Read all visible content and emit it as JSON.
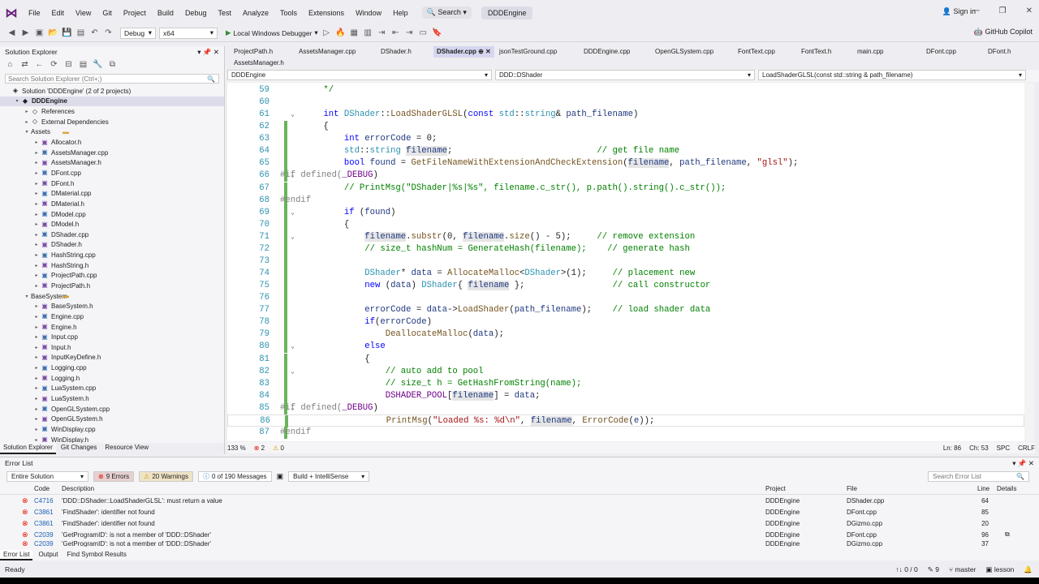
{
  "menubar": {
    "items": [
      "File",
      "Edit",
      "View",
      "Git",
      "Project",
      "Build",
      "Debug",
      "Test",
      "Analyze",
      "Tools",
      "Extensions",
      "Window",
      "Help"
    ],
    "search": "Search",
    "solution": "DDDEngine",
    "signin": "Sign in"
  },
  "toolbar": {
    "config": "Debug",
    "platform": "x64",
    "run": "Local Windows Debugger",
    "copilot": "GitHub Copilot"
  },
  "solution_explorer": {
    "title": "Solution Explorer",
    "search_placeholder": "Search Solution Explorer (Ctrl+;)",
    "rows": [
      {
        "label": "Solution 'DDDEngine' (2 of 2 projects)",
        "indent": 0,
        "icon": "sln",
        "twist": ""
      },
      {
        "label": "DDDEngine",
        "indent": 1,
        "icon": "proj",
        "twist": "▾",
        "bold": true,
        "selected": true
      },
      {
        "label": "References",
        "indent": 2,
        "icon": "ref",
        "twist": "▸"
      },
      {
        "label": "External Dependencies",
        "indent": 2,
        "icon": "ref",
        "twist": "▸"
      },
      {
        "label": "Assets",
        "indent": 2,
        "icon": "fold",
        "twist": "▾"
      },
      {
        "label": "Allocator.h",
        "indent": 3,
        "icon": "h",
        "twist": "▸"
      },
      {
        "label": "AssetsManager.cpp",
        "indent": 3,
        "icon": "cpp",
        "twist": "▸"
      },
      {
        "label": "AssetsManager.h",
        "indent": 3,
        "icon": "h",
        "twist": "▸"
      },
      {
        "label": "DFont.cpp",
        "indent": 3,
        "icon": "cpp",
        "twist": "▸"
      },
      {
        "label": "DFont.h",
        "indent": 3,
        "icon": "h",
        "twist": "▸"
      },
      {
        "label": "DMaterial.cpp",
        "indent": 3,
        "icon": "cpp",
        "twist": "▸"
      },
      {
        "label": "DMaterial.h",
        "indent": 3,
        "icon": "h",
        "twist": "▸"
      },
      {
        "label": "DModel.cpp",
        "indent": 3,
        "icon": "cpp",
        "twist": "▸"
      },
      {
        "label": "DModel.h",
        "indent": 3,
        "icon": "h",
        "twist": "▸"
      },
      {
        "label": "DShader.cpp",
        "indent": 3,
        "icon": "cpp",
        "twist": "▸"
      },
      {
        "label": "DShader.h",
        "indent": 3,
        "icon": "h",
        "twist": "▸"
      },
      {
        "label": "HashString.cpp",
        "indent": 3,
        "icon": "cpp",
        "twist": "▸"
      },
      {
        "label": "HashString.h",
        "indent": 3,
        "icon": "h",
        "twist": "▸"
      },
      {
        "label": "ProjectPath.cpp",
        "indent": 3,
        "icon": "cpp",
        "twist": "▸"
      },
      {
        "label": "ProjectPath.h",
        "indent": 3,
        "icon": "h",
        "twist": "▸"
      },
      {
        "label": "BaseSystem",
        "indent": 2,
        "icon": "fold",
        "twist": "▾"
      },
      {
        "label": "BaseSystem.h",
        "indent": 3,
        "icon": "h",
        "twist": "▸"
      },
      {
        "label": "Engine.cpp",
        "indent": 3,
        "icon": "cpp",
        "twist": "▸"
      },
      {
        "label": "Engine.h",
        "indent": 3,
        "icon": "h",
        "twist": "▸"
      },
      {
        "label": "Input.cpp",
        "indent": 3,
        "icon": "cpp",
        "twist": "▸"
      },
      {
        "label": "Input.h",
        "indent": 3,
        "icon": "h",
        "twist": "▸"
      },
      {
        "label": "InputKeyDefine.h",
        "indent": 3,
        "icon": "h",
        "twist": "▸"
      },
      {
        "label": "Logging.cpp",
        "indent": 3,
        "icon": "cpp",
        "twist": "▸"
      },
      {
        "label": "Logging.h",
        "indent": 3,
        "icon": "h",
        "twist": "▸"
      },
      {
        "label": "LuaSystem.cpp",
        "indent": 3,
        "icon": "cpp",
        "twist": "▸"
      },
      {
        "label": "LuaSystem.h",
        "indent": 3,
        "icon": "h",
        "twist": "▸"
      },
      {
        "label": "OpenGLSystem.cpp",
        "indent": 3,
        "icon": "cpp",
        "twist": "▸"
      },
      {
        "label": "OpenGLSystem.h",
        "indent": 3,
        "icon": "h",
        "twist": "▸"
      },
      {
        "label": "WinDisplay.cpp",
        "indent": 3,
        "icon": "cpp",
        "twist": "▸"
      },
      {
        "label": "WinDisplay.h",
        "indent": 3,
        "icon": "h",
        "twist": "▸"
      }
    ],
    "tabs": [
      "Solution Explorer",
      "Git Changes",
      "Resource View"
    ]
  },
  "doc_tabs": [
    {
      "label": "ProjectPath.h",
      "active": false
    },
    {
      "label": "AssetsManager.cpp",
      "active": false
    },
    {
      "label": "DShader.h",
      "active": false
    },
    {
      "label": "DShader.cpp",
      "active": true
    },
    {
      "label": "jsonTestGround.cpp",
      "active": false
    },
    {
      "label": "DDDEngine.cpp",
      "active": false
    },
    {
      "label": "OpenGLSystem.cpp",
      "active": false
    },
    {
      "label": "FontText.cpp",
      "active": false
    },
    {
      "label": "FontText.h",
      "active": false
    },
    {
      "label": "main.cpp",
      "active": false
    },
    {
      "label": "DFont.cpp",
      "active": false
    },
    {
      "label": "DFont.h",
      "active": false
    },
    {
      "label": "AssetsManager.h",
      "active": false
    }
  ],
  "navbar": {
    "project": "DDDEngine",
    "scope": "DDD::DShader",
    "member": "LoadShaderGLSL(const std::string & path_filename)"
  },
  "editor": {
    "lines": [
      {
        "n": "59",
        "text": "    */",
        "k": "cm",
        "chg": false,
        "fold": ""
      },
      {
        "n": "60",
        "text": "",
        "chg": false,
        "fold": ""
      },
      {
        "n": "61",
        "text": "    int DShader::LoadShaderGLSL(const std::string& path_filename)",
        "chg": false,
        "fold": "v"
      },
      {
        "n": "62",
        "text": "    {",
        "chg": true,
        "fold": ""
      },
      {
        "n": "63",
        "text": "        int errorCode = 0;",
        "chg": true,
        "fold": ""
      },
      {
        "n": "64",
        "text": "        std::string filename;                            // get file name",
        "chg": true,
        "fold": ""
      },
      {
        "n": "65",
        "text": "        bool found = GetFileNameWithExtensionAndCheckExtension(filename, path_filename, \"glsl\");",
        "chg": true,
        "fold": ""
      },
      {
        "n": "66",
        "text": "#if defined(_DEBUG)",
        "chg": true,
        "fold": "v",
        "pp": true
      },
      {
        "n": "67",
        "text": "        // PrintMsg(\"DShader|%s|%s\", filename.c_str(), p.path().string().c_str());",
        "chg": true,
        "fold": ""
      },
      {
        "n": "68",
        "text": "#endif",
        "chg": true,
        "fold": "",
        "pp": true
      },
      {
        "n": "69",
        "text": "        if (found)",
        "chg": true,
        "fold": "v"
      },
      {
        "n": "70",
        "text": "        {",
        "chg": true,
        "fold": ""
      },
      {
        "n": "71",
        "text": "            filename.substr(0, filename.size() - 5);     // remove extension",
        "chg": true,
        "fold": "v"
      },
      {
        "n": "72",
        "text": "            // size_t hashNum = GenerateHash(filename);    // generate hash",
        "chg": true,
        "fold": ""
      },
      {
        "n": "73",
        "text": "",
        "chg": true,
        "fold": ""
      },
      {
        "n": "74",
        "text": "            DShader* data = AllocateMalloc<DShader>(1);     // placement new",
        "chg": true,
        "fold": ""
      },
      {
        "n": "75",
        "text": "            new (data) DShader{ filename };                 // call constructor",
        "chg": true,
        "fold": ""
      },
      {
        "n": "76",
        "text": "",
        "chg": true,
        "fold": ""
      },
      {
        "n": "77",
        "text": "            errorCode = data->LoadShader(path_filename);    // load shader data",
        "chg": true,
        "fold": ""
      },
      {
        "n": "78",
        "text": "            if(errorCode)",
        "chg": true,
        "fold": ""
      },
      {
        "n": "79",
        "text": "                DeallocateMalloc(data);",
        "chg": true,
        "fold": ""
      },
      {
        "n": "80",
        "text": "            else",
        "chg": true,
        "fold": "v"
      },
      {
        "n": "81",
        "text": "            {",
        "chg": true,
        "fold": ""
      },
      {
        "n": "82",
        "text": "                // auto add to pool",
        "chg": true,
        "fold": "v"
      },
      {
        "n": "83",
        "text": "                // size_t h = GetHashFromString(name);",
        "chg": true,
        "fold": ""
      },
      {
        "n": "84",
        "text": "                DSHADER_POOL[filename] = data;",
        "chg": true,
        "fold": ""
      },
      {
        "n": "85",
        "text": "#if defined(_DEBUG)",
        "chg": true,
        "fold": "v",
        "pp": true
      },
      {
        "n": "86",
        "text": "                PrintMsg(\"Loaded %s: %d\\n\", filename, ErrorCode(e));",
        "chg": true,
        "fold": "",
        "cur": true
      },
      {
        "n": "87",
        "text": "#endif",
        "chg": true,
        "fold": "",
        "pp": true
      }
    ]
  },
  "editor_status": {
    "zoom": "133 %",
    "errors": "2",
    "warnings": "0",
    "position": "Ln: 86",
    "col": "Ch: 53",
    "ins": "SPC",
    "eol": "CRLF"
  },
  "error_list": {
    "title": "Error List",
    "scope": "Entire Solution",
    "errors_btn": "9 Errors",
    "warnings_btn": "20 Warnings",
    "messages_btn": "0 of 190 Messages",
    "build": "Build + IntelliSense",
    "search": "Search Error List",
    "columns": [
      "Code",
      "Description",
      "Project",
      "File",
      "Line",
      "Details"
    ],
    "rows": [
      {
        "code": "C4716",
        "desc": "'DDD::DShader::LoadShaderGLSL': must return a value",
        "project": "DDDEngine",
        "file": "DShader.cpp",
        "line": "64"
      },
      {
        "code": "C3861",
        "desc": "'FindShader': identifier not found",
        "project": "DDDEngine",
        "file": "DFont.cpp",
        "line": "85"
      },
      {
        "code": "C3861",
        "desc": "'FindShader': identifier not found",
        "project": "DDDEngine",
        "file": "DGizmo.cpp",
        "line": "20"
      },
      {
        "code": "C2039",
        "desc": "'GetProgramID': is not a member of 'DDD::DShader'",
        "project": "DDDEngine",
        "file": "DFont.cpp",
        "line": "96"
      },
      {
        "code": "C2039",
        "desc": "'GetProgramID': is not a member of 'DDD::DShader'",
        "project": "DDDEngine",
        "file": "DGizmo.cpp",
        "line": "37"
      }
    ],
    "tabs": [
      "Error List",
      "Output",
      "Find Symbol Results"
    ]
  },
  "statusbar": {
    "ready": "Ready",
    "updown": "0 / 0",
    "pencil": "9",
    "branch": "master",
    "repo": "lesson"
  }
}
